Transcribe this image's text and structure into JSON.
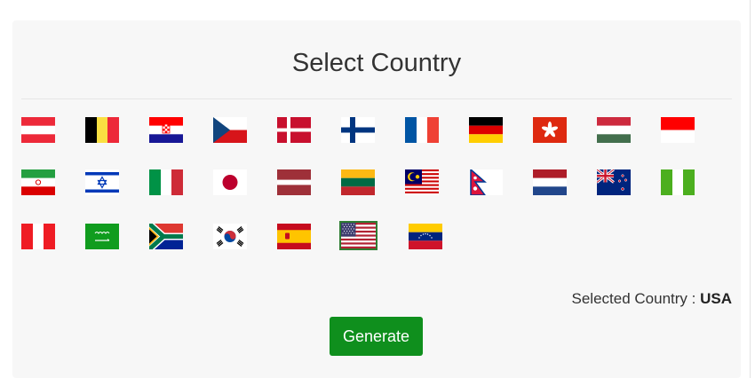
{
  "title": "Select Country",
  "selected_label": "Selected Country :",
  "selected_value": "USA",
  "generate_button": "Generate",
  "flags": [
    {
      "name": "austria-flag-icon"
    },
    {
      "name": "belgium-flag-icon"
    },
    {
      "name": "croatia-flag-icon"
    },
    {
      "name": "czech-republic-flag-icon"
    },
    {
      "name": "denmark-flag-icon"
    },
    {
      "name": "finland-flag-icon"
    },
    {
      "name": "france-flag-icon"
    },
    {
      "name": "germany-flag-icon"
    },
    {
      "name": "hong-kong-flag-icon"
    },
    {
      "name": "hungary-flag-icon"
    },
    {
      "name": "indonesia-flag-icon"
    },
    {
      "name": "iran-flag-icon"
    },
    {
      "name": "israel-flag-icon"
    },
    {
      "name": "italy-flag-icon"
    },
    {
      "name": "japan-flag-icon"
    },
    {
      "name": "latvia-flag-icon"
    },
    {
      "name": "lithuania-flag-icon"
    },
    {
      "name": "malaysia-flag-icon"
    },
    {
      "name": "nepal-flag-icon"
    },
    {
      "name": "netherlands-flag-icon"
    },
    {
      "name": "new-zealand-flag-icon"
    },
    {
      "name": "nigeria-flag-icon"
    },
    {
      "name": "peru-flag-icon"
    },
    {
      "name": "saudi-arabia-flag-icon"
    },
    {
      "name": "south-africa-flag-icon"
    },
    {
      "name": "south-korea-flag-icon"
    },
    {
      "name": "spain-flag-icon"
    },
    {
      "name": "usa-flag-icon",
      "selected": true
    },
    {
      "name": "venezuela-flag-icon"
    }
  ],
  "colors": {
    "panel_bg": "#f7f7f7",
    "button_bg": "#0f8f1d",
    "selected_border": "#2e7d32"
  }
}
